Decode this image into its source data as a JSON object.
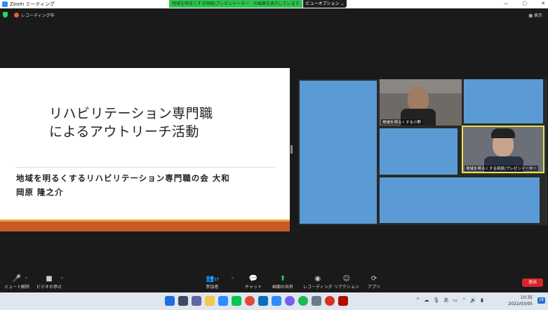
{
  "window": {
    "title": "Zoom ミーティング",
    "share_banner": "地域を明るくする岡原/プレゼンテーター　の画面を表示しています",
    "view_options": "ビューオプション ⌄",
    "controls": [
      "—",
      "▢",
      "✕"
    ]
  },
  "status": {
    "recording": "レコーディング中",
    "view": "表示"
  },
  "slide": {
    "title": "リハビリテーション専門職\nによるアウトリーチ活動",
    "org": "地域を明るくするリハビリテーション専門職の会 大和",
    "presenter": "岡原 隆之介"
  },
  "participants": {
    "tile1_label": "地域を明るくする小野",
    "tile2_label": "地域を明るくする岡原/プレゼンテーター"
  },
  "toolbar": {
    "mute": "ミュート解除",
    "video": "ビデオの停止",
    "participants": "参加者",
    "participants_count": "17",
    "chat": "チャット",
    "share": "画面の共有",
    "record": "レコーディング",
    "reactions": "リアクション",
    "apps": "アプリ",
    "leave": "退出"
  },
  "taskbar": {
    "time": "10:35",
    "date": "2022/03/05",
    "ime": "あ",
    "notifications": "18"
  },
  "colors": {
    "accent_green": "#23d959",
    "leave_red": "#d9262b",
    "tile_blue": "#5b9bd5",
    "active_speaker": "#e8e04a"
  }
}
